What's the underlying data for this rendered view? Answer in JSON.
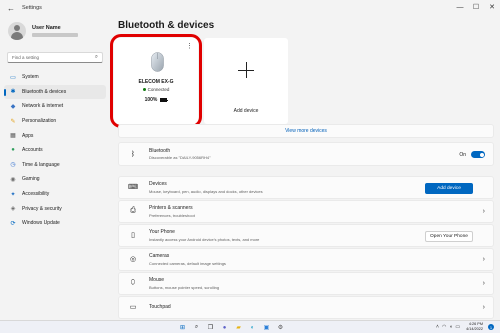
{
  "window": {
    "title": "Settings",
    "back_glyph": "←",
    "min_glyph": "—",
    "max_glyph": "☐",
    "close_glyph": "✕"
  },
  "user": {
    "name": "User Name"
  },
  "search": {
    "placeholder": "Find a setting",
    "icon": "⌕"
  },
  "sidebar": {
    "items": [
      {
        "label": "System",
        "icon": "▭",
        "color": "#0067c0"
      },
      {
        "label": "Bluetooth & devices",
        "icon": "✱",
        "color": "#0067c0",
        "active": true
      },
      {
        "label": "Network & internet",
        "icon": "◆",
        "color": "#3a74c4"
      },
      {
        "label": "Personalization",
        "icon": "✎",
        "color": "#e3a21a"
      },
      {
        "label": "Apps",
        "icon": "▦",
        "color": "#555555"
      },
      {
        "label": "Accounts",
        "icon": "●",
        "color": "#2e9e5b"
      },
      {
        "label": "Time & language",
        "icon": "◷",
        "color": "#2f6fd0"
      },
      {
        "label": "Gaming",
        "icon": "◉",
        "color": "#707070"
      },
      {
        "label": "Accessibility",
        "icon": "✦",
        "color": "#1f6fc4"
      },
      {
        "label": "Privacy & security",
        "icon": "◈",
        "color": "#707070"
      },
      {
        "label": "Windows Update",
        "icon": "⟳",
        "color": "#0067c0"
      }
    ]
  },
  "page": {
    "title": "Bluetooth & devices"
  },
  "device": {
    "name": "ELECOM EX-G",
    "status": "Connected",
    "battery": "100%",
    "menu_glyph": "⋮"
  },
  "add_device_card": {
    "label": "Add device"
  },
  "view_more": "View more devices",
  "bluetooth": {
    "icon": "ᛒ",
    "title": "Bluetooth",
    "desc": "Discoverable as \"DAILY-9056RH4\"",
    "toggle_label": "On",
    "enabled": true
  },
  "rows": [
    {
      "icon": "⌨",
      "title": "Devices",
      "desc": "Mouse, keyboard, pen, audio, displays and docks, other devices",
      "button": "Add device",
      "button_style": "primary"
    },
    {
      "icon": "⎙",
      "title": "Printers & scanners",
      "desc": "Preferences, troubleshoot",
      "chevron": "›"
    },
    {
      "icon": "▯",
      "title": "Your Phone",
      "desc": "Instantly access your Android device's photos, texts, and more",
      "button": "Open Your Phone",
      "button_style": "secondary"
    },
    {
      "icon": "◎",
      "title": "Cameras",
      "desc": "Connected cameras, default image settings",
      "chevron": "›"
    },
    {
      "icon": "⬯",
      "title": "Mouse",
      "desc": "Buttons, mouse pointer speed, scrolling",
      "chevron": "›"
    },
    {
      "icon": "▭",
      "title": "Touchpad",
      "desc": "",
      "chevron": "›"
    }
  ],
  "taskbar": {
    "icons": [
      {
        "name": "start-icon",
        "glyph": "⊞",
        "color": "#0067c0"
      },
      {
        "name": "search-icon",
        "glyph": "⌕",
        "color": "#222222"
      },
      {
        "name": "task-view-icon",
        "glyph": "❐",
        "color": "#222222"
      },
      {
        "name": "chat-icon",
        "glyph": "●",
        "color": "#5b5fc7"
      },
      {
        "name": "file-explorer-icon",
        "glyph": "▰",
        "color": "#e7b416"
      },
      {
        "name": "edge-icon",
        "glyph": "◐",
        "color": "#1fa0c8"
      },
      {
        "name": "store-icon",
        "glyph": "▣",
        "color": "#2b7fd8"
      },
      {
        "name": "settings-icon",
        "glyph": "⚙",
        "color": "#555555"
      }
    ],
    "tray_up": "˄",
    "wifi": "◠",
    "volume": "◖",
    "battery": "▭",
    "time": "4:26 PM",
    "date": "4/14/2022",
    "notifications": "1"
  }
}
